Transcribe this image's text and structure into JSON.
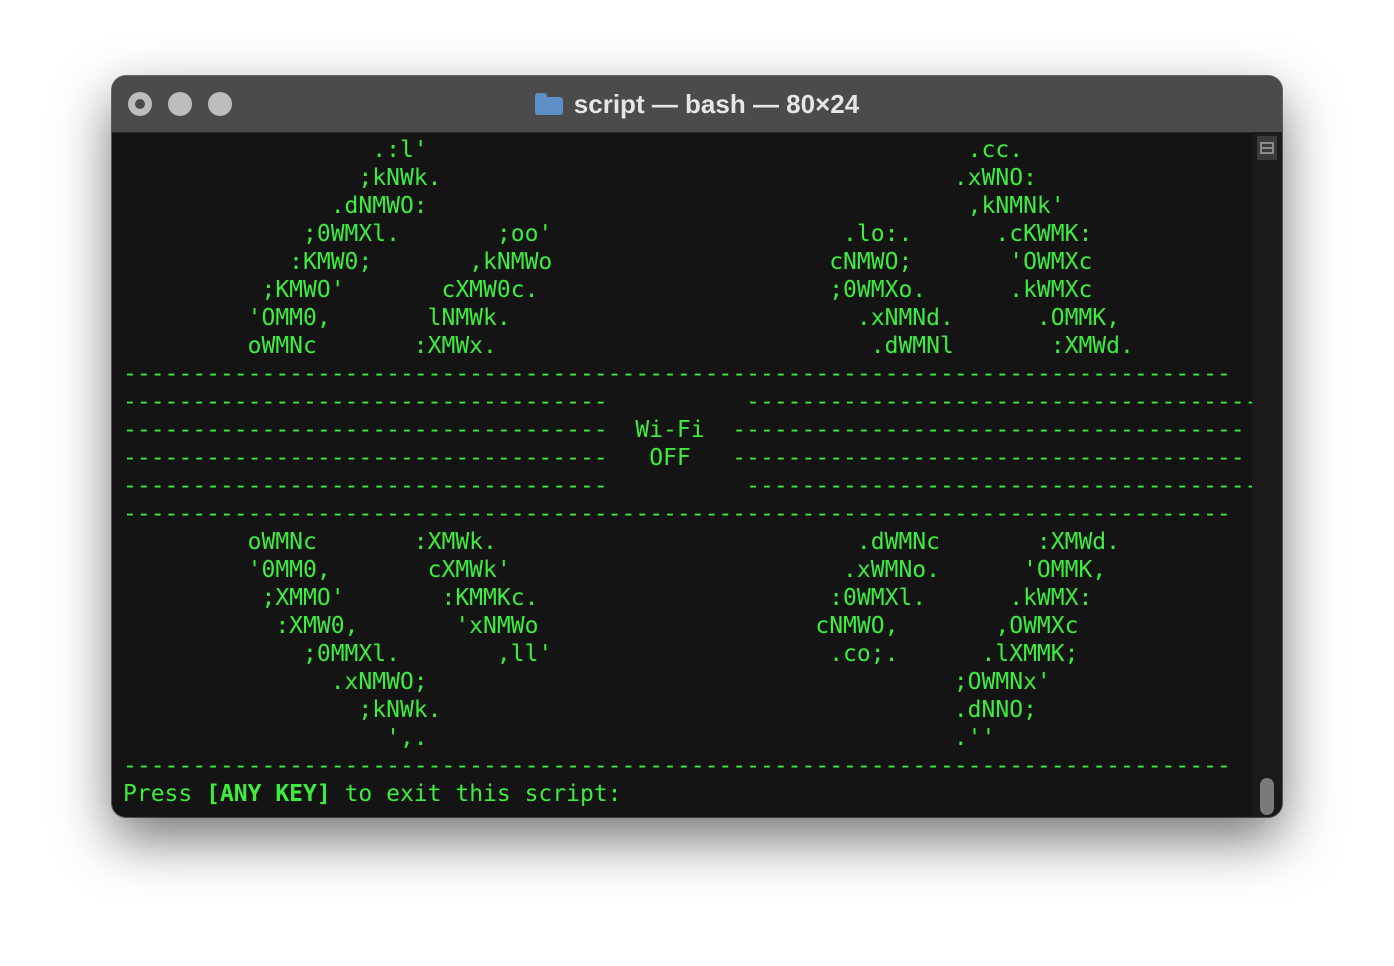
{
  "window": {
    "title": "script — bash — 80×24",
    "title_icon": "folder-icon"
  },
  "terminal": {
    "text_color": "#3ded3d",
    "background": "#141414",
    "lines": [
      "                  .:l'                                       .cc.",
      "                 ;kNWk.                                     .xWNO:",
      "               .dNMWO:                                       ,kNMNk'",
      "             ;0WMXl.       ;oo'                     .lo:.      .cKWMK:",
      "            :KMW0;       ,kNMWo                    cNMWO;       'OWMXc",
      "          ;KMWO'       cXMW0c.                     ;0WMXo.      .kWMXc",
      "         'OMM0,       lNMWk.                         .xNMNd.      .OMMK,",
      "         oWMNc       :XMWx.                           .dWMNl       :XMWd.",
      "--------------------------------------------------------------------------------",
      "-----------------------------------          -------------------------------------",
      "-----------------------------------  Wi-Fi  -------------------------------------",
      "-----------------------------------   OFF   -------------------------------------",
      "-----------------------------------          -------------------------------------",
      "--------------------------------------------------------------------------------",
      "         oWMNc       :XMWk.                          .dWMNc       :XMWd.",
      "         '0MM0,       cXMWk'                        .xWMNo.      'OMMK,",
      "          ;XMMO'       :KMMKc.                     :0WMXl.      .kWMX:",
      "           :XMW0,       'xNMWo                    cNMWO,       ,OWMXc",
      "             ;0MMXl.       ,ll'                    .co;.      .lXMMK;",
      "               .xNMWO;                                      ;OWMNx'",
      "                 ;kNWk.                                     .dNNO;",
      "                   ',.                                      .''",
      "--------------------------------------------------------------------------------"
    ],
    "prompt": {
      "before": "Press ",
      "key": "[ANY KEY]",
      "after": " to exit this script:"
    }
  }
}
